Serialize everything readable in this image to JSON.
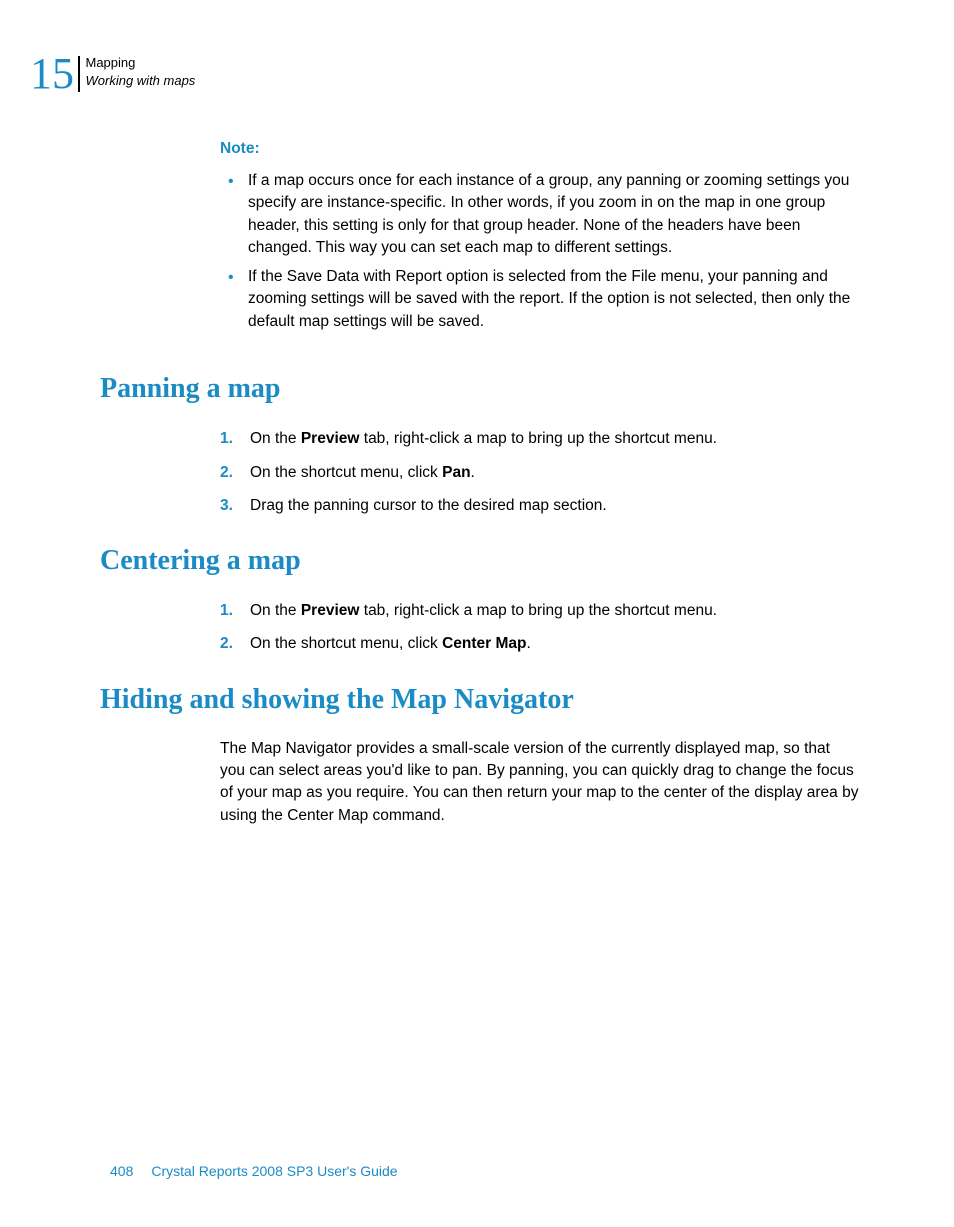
{
  "header": {
    "chapter_number": "15",
    "line1": "Mapping",
    "line2": "Working with maps"
  },
  "note": {
    "label": "Note:",
    "items": [
      "If a map occurs once for each instance of a group, any panning or zooming settings you specify are instance-specific. In other words, if you zoom in on the map in one group header, this setting is only for that group header. None of the headers have been changed. This way you can set each map to different settings.",
      "If the Save Data with Report option is selected from the File menu, your panning and zooming settings will be saved with the report. If the option is not selected, then only the default map settings will be saved."
    ]
  },
  "sections": {
    "panning": {
      "heading": "Panning a map",
      "steps": {
        "s1_pre": "On the ",
        "s1_b": "Preview",
        "s1_post": " tab, right-click a map to bring up the shortcut menu.",
        "s2_pre": "On the shortcut menu, click ",
        "s2_b": "Pan",
        "s2_post": ".",
        "s3": "Drag the panning cursor to the desired map section."
      }
    },
    "centering": {
      "heading": "Centering a map",
      "steps": {
        "s1_pre": "On the ",
        "s1_b": "Preview",
        "s1_post": " tab, right-click a map to bring up the shortcut menu.",
        "s2_pre": "On the shortcut menu, click ",
        "s2_b": "Center Map",
        "s2_post": "."
      }
    },
    "hiding": {
      "heading": "Hiding and showing the Map Navigator",
      "para": "The Map Navigator provides a small-scale version of the currently displayed map, so that you can select areas you'd like to pan. By panning, you can quickly drag to change the focus of your map as you require. You can then return your map to the center of the display area by using the Center Map command."
    }
  },
  "footer": {
    "page_number": "408",
    "doc_title": "Crystal Reports 2008 SP3 User's Guide"
  }
}
